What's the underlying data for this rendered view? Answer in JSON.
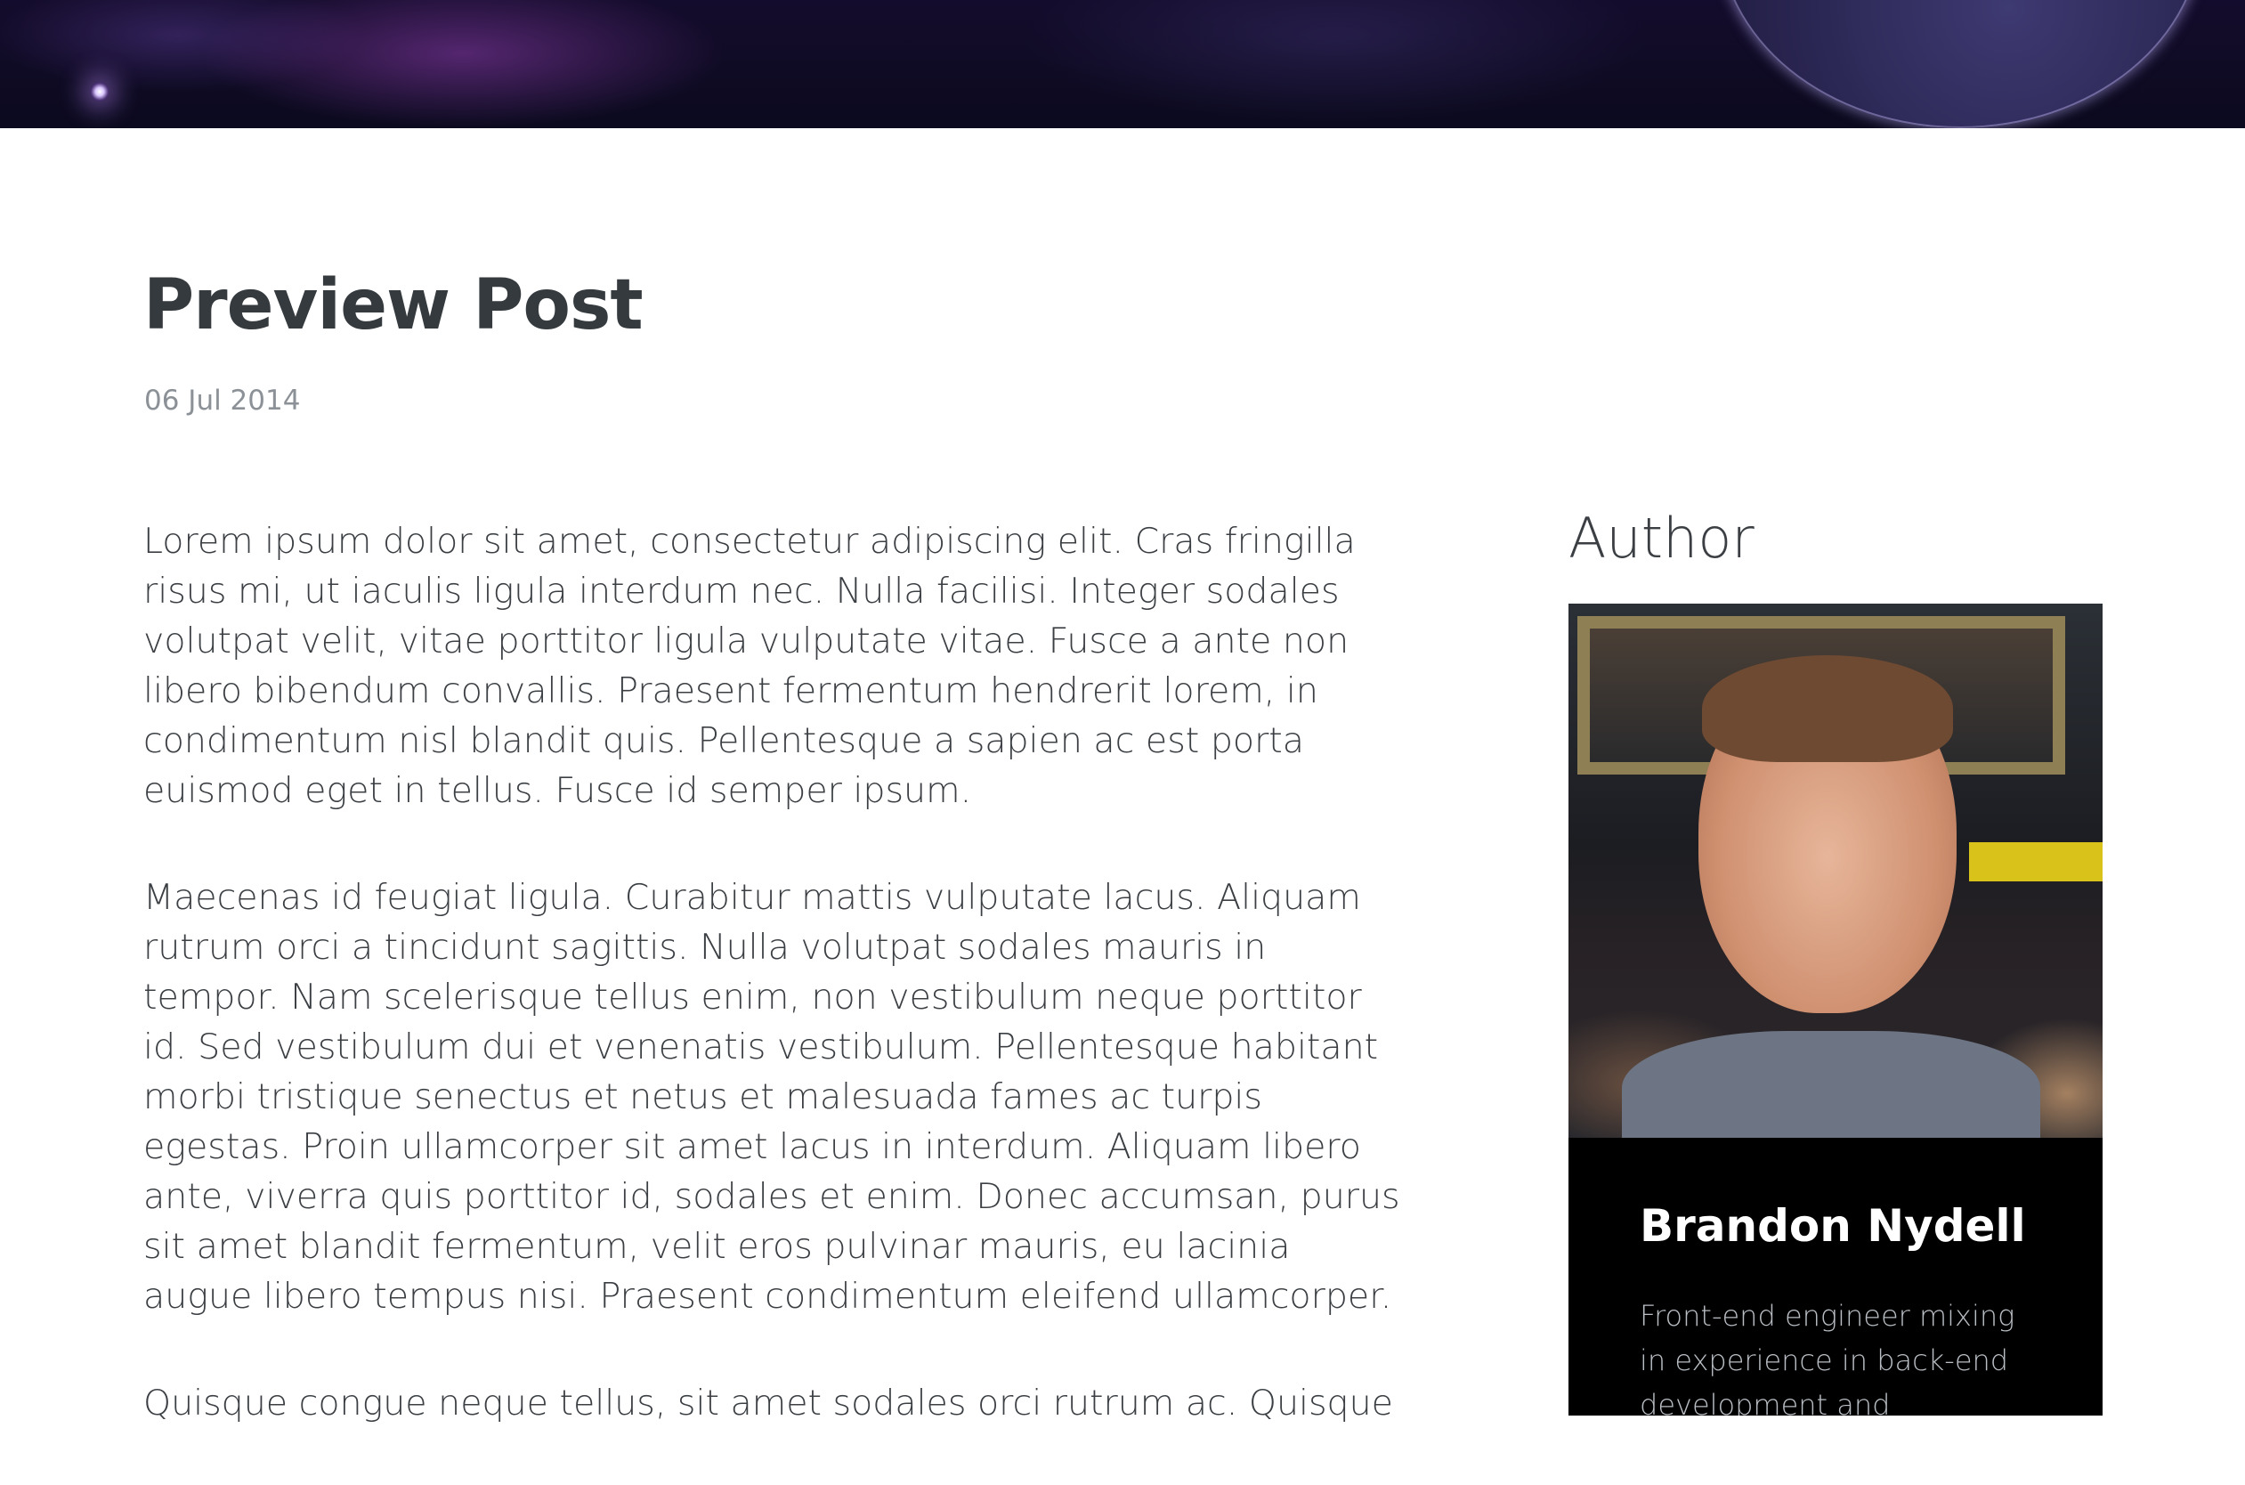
{
  "post": {
    "title": "Preview Post",
    "date": "06 Jul 2014",
    "paragraphs": [
      "Lorem ipsum dolor sit amet, consectetur adipiscing elit. Cras fringilla risus mi, ut iaculis ligula interdum nec. Nulla facilisi. Integer sodales volutpat velit, vitae porttitor ligula vulputate vitae. Fusce a ante non libero bibendum convallis. Praesent fermentum hendrerit lorem, in condimentum nisl blandit quis. Pellentesque a sapien ac est porta euismod eget in tellus. Fusce id semper ipsum.",
      "Maecenas id feugiat ligula. Curabitur mattis vulputate lacus. Aliquam rutrum orci a tincidunt sagittis. Nulla volutpat sodales mauris in tempor. Nam scelerisque tellus enim, non vestibulum neque porttitor id. Sed vestibulum dui et venenatis vestibulum. Pellentesque habitant morbi tristique senectus et netus et malesuada fames ac turpis egestas. Proin ullamcorper sit amet lacus in interdum. Aliquam libero ante, viverra quis porttitor id, sodales et enim. Donec accumsan, purus sit amet blandit fermentum, velit eros pulvinar mauris, eu lacinia augue libero tempus nisi. Praesent condimentum eleifend ullamcorper.",
      "Quisque congue neque tellus, sit amet sodales orci rutrum ac. Quisque"
    ]
  },
  "sidebar": {
    "heading": "Author",
    "author_name": "Brandon Nydell",
    "author_bio": "Front-end engineer mixing in experience in back-end development and marketing",
    "photo_icon": "author-photo"
  },
  "colors": {
    "title": "#353a3e",
    "body_text": "#3b3f43",
    "date": "#8b9196",
    "card_bg": "#000000",
    "card_bio": "#b9bec4"
  }
}
